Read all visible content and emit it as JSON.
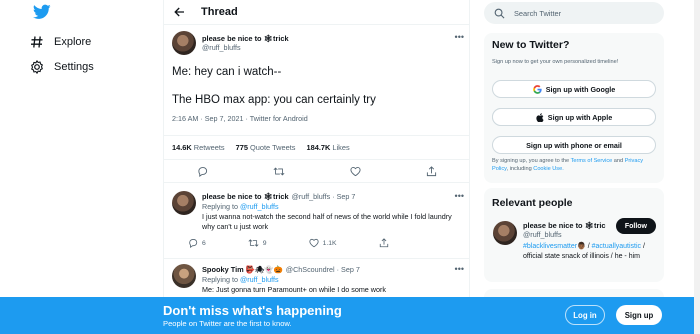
{
  "nav": {
    "explore": "Explore",
    "settings": "Settings"
  },
  "thread_header": {
    "title": "Thread"
  },
  "main_tweet": {
    "name": "please be nice to 🕸trick",
    "handle": "@ruff_bluffs",
    "line1": "Me: hey can i watch--",
    "line2": "The HBO max app: you can certainly try",
    "meta": "2:16 AM · Sep 7, 2021 · Twitter for Android",
    "retweets_count": "14.6K",
    "retweets_label": "Retweets",
    "quotes_count": "775",
    "quotes_label": "Quote Tweets",
    "likes_count": "184.7K",
    "likes_label": "Likes"
  },
  "replies": [
    {
      "name": "please be nice to 🕸trick",
      "handle_date": "@ruff_bluffs · Sep 7",
      "replying_prefix": "Replying to",
      "replying_handle": "@ruff_bluffs",
      "text": "I just wanna not-watch the second half of news of the world while I fold laundry why can't u just work",
      "replies": "6",
      "retweets": "9",
      "likes": "1.1K"
    },
    {
      "name": "Spooky Tim 👺🕷👻🎃",
      "handle_date": "@ChScoundrel · Sep 7",
      "replying_prefix": "Replying to",
      "replying_handle": "@ruff_bluffs",
      "text": "Me: Just gonna turn Paramount+ on while I do some work"
    }
  ],
  "search": {
    "placeholder": "Search Twitter"
  },
  "new_to_twitter": {
    "title": "New to Twitter?",
    "subtitle": "Sign up now to get your own personalized timeline!",
    "google": "Sign up with Google",
    "apple": "Sign up with Apple",
    "phone": "Sign up with phone or email",
    "legal_prefix": "By signing up, you agree to the",
    "terms": "Terms of Service",
    "and": "and",
    "privacy": "Privacy Policy",
    "including": ", including",
    "cookie": "Cookie Use."
  },
  "relevant_people": {
    "title": "Relevant people",
    "name": "please be nice to 🕸tric",
    "handle": "@ruff_bluffs",
    "follow": "Follow",
    "bio_tag1": "#blacklivesmatter",
    "bio_emoji": "👨🏾",
    "bio_tag2": "#actuallyautistic",
    "bio_rest": "official state snack of illinois / he - him"
  },
  "banner": {
    "headline": "Don't miss what's happening",
    "subline": "People on Twitter are the first to know.",
    "login": "Log in",
    "signup": "Sign up"
  },
  "colors": {
    "accent": "#1d9bf0",
    "text": "#0f1419",
    "muted": "#536471"
  }
}
